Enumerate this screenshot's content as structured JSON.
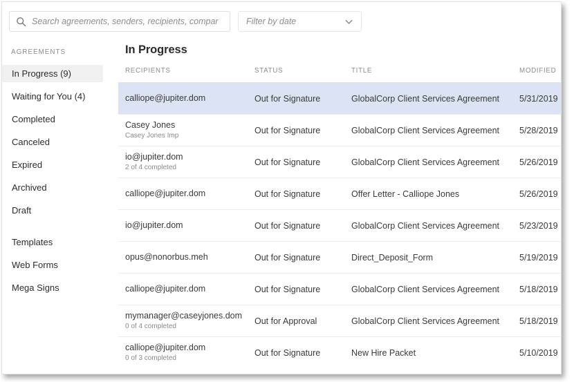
{
  "search": {
    "placeholder": "Search agreements, senders, recipients, company...",
    "value": "",
    "icon": "search-icon"
  },
  "filter": {
    "label": "Filter by date",
    "icon": "chevron-down-icon"
  },
  "sidebar": {
    "section_title": "AGREEMENTS",
    "items": [
      {
        "label": "In Progress (9)",
        "active": true
      },
      {
        "label": "Waiting for You (4)",
        "active": false
      },
      {
        "label": "Completed",
        "active": false
      },
      {
        "label": "Canceled",
        "active": false
      },
      {
        "label": "Expired",
        "active": false
      },
      {
        "label": "Archived",
        "active": false
      },
      {
        "label": "Draft",
        "active": false
      }
    ],
    "items2": [
      {
        "label": "Templates"
      },
      {
        "label": "Web Forms"
      },
      {
        "label": "Mega Signs"
      }
    ]
  },
  "main": {
    "title": "In Progress",
    "columns": {
      "recipients": "RECIPIENTS",
      "status": "STATUS",
      "title": "TITLE",
      "modified": "MODIFIED"
    },
    "rows": [
      {
        "recipient": "calliope@jupiter.dom",
        "recipient_sub": "",
        "status": "Out for Signature",
        "title": "GlobalCorp Client Services Agreement",
        "modified": "5/31/2019",
        "selected": true
      },
      {
        "recipient": "Casey Jones",
        "recipient_sub": "Casey Jones Imp",
        "status": "Out for Signature",
        "title": "GlobalCorp Client Services Agreement",
        "modified": "5/28/2019",
        "selected": false
      },
      {
        "recipient": "io@jupiter.dom",
        "recipient_sub": "2 of 4 completed",
        "status": "Out for Signature",
        "title": "GlobalCorp Client Services Agreement",
        "modified": "5/26/2019",
        "selected": false
      },
      {
        "recipient": "calliope@jupiter.dom",
        "recipient_sub": "",
        "status": "Out for Signature",
        "title": "Offer Letter - Calliope Jones",
        "modified": "5/26/2019",
        "selected": false
      },
      {
        "recipient": "io@jupiter.dom",
        "recipient_sub": "",
        "status": "Out for Signature",
        "title": "GlobalCorp Client Services Agreement",
        "modified": "5/23/2019",
        "selected": false
      },
      {
        "recipient": "opus@nonorbus.meh",
        "recipient_sub": "",
        "status": "Out for Signature",
        "title": "Direct_Deposit_Form",
        "modified": "5/19/2019",
        "selected": false
      },
      {
        "recipient": "calliope@jupiter.dom",
        "recipient_sub": "",
        "status": "Out for Signature",
        "title": "GlobalCorp Client Services Agreement",
        "modified": "5/18/2019",
        "selected": false
      },
      {
        "recipient": "mymanager@caseyjones.dom",
        "recipient_sub": "0 of 4 completed",
        "status": "Out for Approval",
        "title": "GlobalCorp Client Services Agreement",
        "modified": "5/18/2019",
        "selected": false
      },
      {
        "recipient": "calliope@jupiter.dom",
        "recipient_sub": "0 of 3 completed",
        "status": "Out for Signature",
        "title": "New Hire Packet",
        "modified": "5/10/2019",
        "selected": false
      }
    ]
  },
  "colors": {
    "selected_row": "#dbe3f4",
    "active_nav": "#f0f0f0",
    "text": "#3a3a3a",
    "muted": "#8d8d8d",
    "divider": "#ececec"
  }
}
